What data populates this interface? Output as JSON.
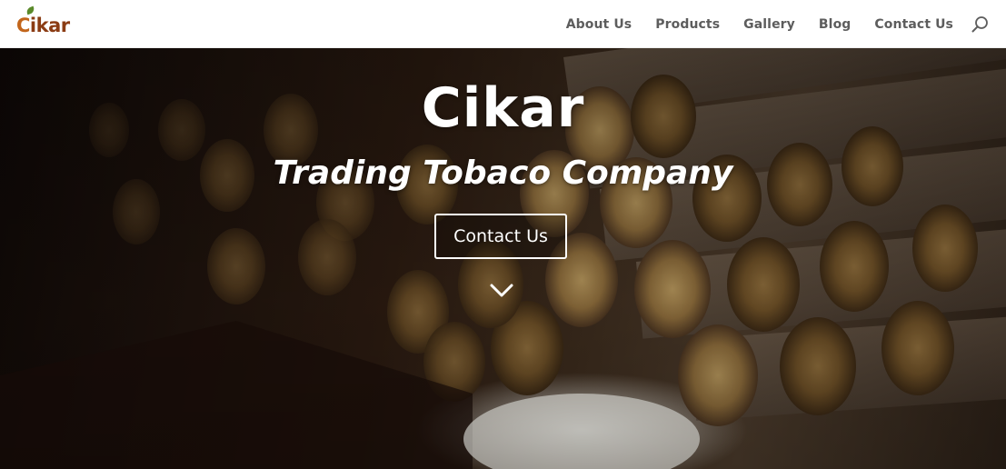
{
  "header": {
    "logo_text_first": "C",
    "logo_text_rest": "ikar",
    "nav": [
      {
        "label": "About Us"
      },
      {
        "label": "Products"
      },
      {
        "label": "Gallery"
      },
      {
        "label": "Blog"
      },
      {
        "label": "Contact Us"
      }
    ],
    "search_icon": "search-icon"
  },
  "hero": {
    "title": "Cikar",
    "subtitle": "Trading Tobaco Company",
    "button_label": "Contact Us",
    "scroll_icon": "chevron-down-icon"
  },
  "colors": {
    "logo_orange": "#c2651b",
    "logo_brown": "#8b3c14",
    "nav_text": "#5d5d5d",
    "hero_text": "#ffffff"
  }
}
